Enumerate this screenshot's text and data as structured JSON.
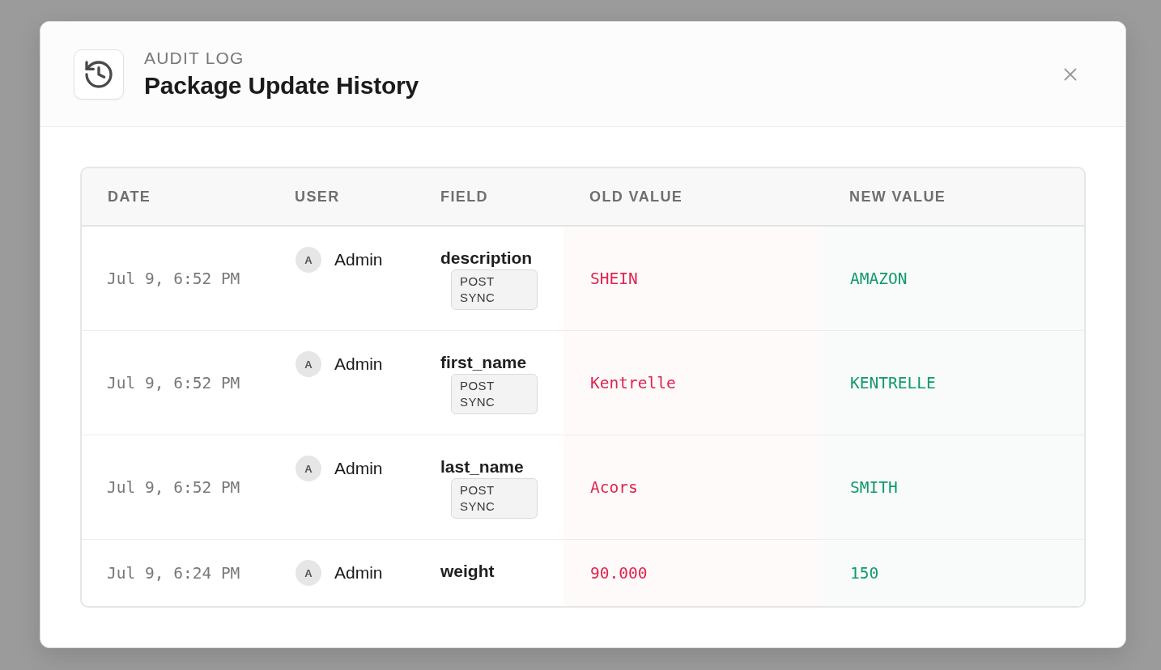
{
  "dialog": {
    "eyebrow": "AUDIT LOG",
    "title": "Package Update History"
  },
  "table": {
    "columns": [
      "DATE",
      "USER",
      "FIELD",
      "OLD VALUE",
      "NEW VALUE"
    ],
    "rows": [
      {
        "date": "Jul 9, 6:52 PM",
        "avatar": "A",
        "user": "Admin",
        "field": "description",
        "tag": "POST SYNC",
        "old_value": "SHEIN",
        "new_value": "AMAZON"
      },
      {
        "date": "Jul 9, 6:52 PM",
        "avatar": "A",
        "user": "Admin",
        "field": "first_name",
        "tag": "POST SYNC",
        "old_value": "Kentrelle",
        "new_value": "KENTRELLE"
      },
      {
        "date": "Jul 9, 6:52 PM",
        "avatar": "A",
        "user": "Admin",
        "field": "last_name",
        "tag": "POST SYNC",
        "old_value": "Acors",
        "new_value": "SMITH"
      },
      {
        "date": "Jul 9, 6:24 PM",
        "avatar": "A",
        "user": "Admin",
        "field": "weight",
        "old_value": "90.000",
        "new_value": "150"
      }
    ]
  }
}
